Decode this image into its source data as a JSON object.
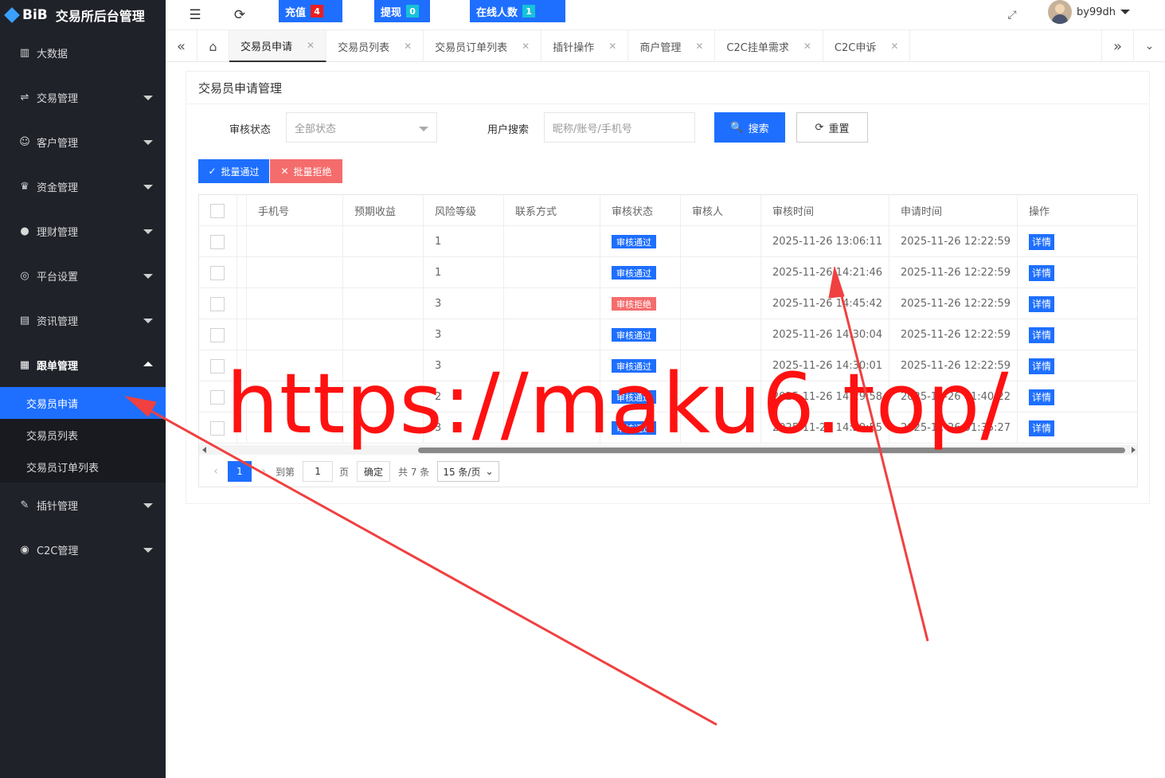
{
  "app": {
    "logo_text": "BiB",
    "title": "交易所后台管理"
  },
  "topbar": {
    "buttons": [
      {
        "label": "充值",
        "count": "4",
        "color": "#f01d1d"
      },
      {
        "label": "提现",
        "count": "0",
        "color": "#16c2d8"
      },
      {
        "label": "在线人数",
        "count": "1",
        "color": "#16c2d8"
      }
    ],
    "username": "by99dh"
  },
  "sidebar": {
    "items": [
      {
        "label": "大数据",
        "icon": "chart-icon"
      },
      {
        "label": "交易管理",
        "icon": "exchange-icon"
      },
      {
        "label": "客户管理",
        "icon": "users-icon"
      },
      {
        "label": "资金管理",
        "icon": "money-bag-icon"
      },
      {
        "label": "理财管理",
        "icon": "piggy-bank-icon"
      },
      {
        "label": "平台设置",
        "icon": "settings-icon"
      },
      {
        "label": "资讯管理",
        "icon": "news-icon"
      },
      {
        "label": "跟单管理",
        "icon": "document-icon"
      },
      {
        "label": "插针管理",
        "icon": "pin-icon"
      },
      {
        "label": "C2C管理",
        "icon": "coin-icon"
      }
    ],
    "sub_items": [
      "交易员申请",
      "交易员列表",
      "交易员订单列表"
    ]
  },
  "tabs": [
    "交易员申请",
    "交易员列表",
    "交易员订单列表",
    "插针操作",
    "商户管理",
    "C2C挂单需求",
    "C2C申诉"
  ],
  "page": {
    "title": "交易员申请管理",
    "status_label": "审核状态",
    "status_value": "全部状态",
    "user_search_label": "用户搜索",
    "user_search_placeholder": "昵称/账号/手机号",
    "search_button": "搜索",
    "reset_button": "重置",
    "batch_pass": "批量通过",
    "batch_reject": "批量拒绝"
  },
  "table": {
    "headers": [
      "手机号",
      "预期收益",
      "风险等级",
      "联系方式",
      "审核状态",
      "审核人",
      "审核时间",
      "申请时间",
      "操作"
    ],
    "rows": [
      {
        "phone": "",
        "profit": "",
        "risk": "1",
        "contact": "",
        "status": "审核通过",
        "status_type": "pass",
        "reviewer": "",
        "review_time": "2025-11-26 13:06:11",
        "apply_time": "2025-11-26 12:22:59",
        "action": "详情"
      },
      {
        "phone": "",
        "profit": "",
        "risk": "1",
        "contact": "",
        "status": "审核通过",
        "status_type": "pass",
        "reviewer": "",
        "review_time": "2025-11-26 14:21:46",
        "apply_time": "2025-11-26 12:22:59",
        "action": "详情"
      },
      {
        "phone": "",
        "profit": "",
        "risk": "3",
        "contact": "",
        "status": "审核拒绝",
        "status_type": "reject",
        "reviewer": "",
        "review_time": "2025-11-26 14:45:42",
        "apply_time": "2025-11-26 12:22:59",
        "action": "详情"
      },
      {
        "phone": "",
        "profit": "",
        "risk": "3",
        "contact": "",
        "status": "审核通过",
        "status_type": "pass",
        "reviewer": "",
        "review_time": "2025-11-26 14:30:04",
        "apply_time": "2025-11-26 12:22:59",
        "action": "详情"
      },
      {
        "phone": "",
        "profit": "",
        "risk": "3",
        "contact": "",
        "status": "审核通过",
        "status_type": "pass",
        "reviewer": "",
        "review_time": "2025-11-26 14:30:01",
        "apply_time": "2025-11-26 12:22:59",
        "action": "详情"
      },
      {
        "phone": "",
        "profit": "",
        "risk": "2",
        "contact": "",
        "status": "审核通过",
        "status_type": "pass",
        "reviewer": "",
        "review_time": "2025-11-26 14:29:58",
        "apply_time": "2025-11-26 01:40:22",
        "action": "详情"
      },
      {
        "phone": "",
        "profit": "",
        "risk": "3",
        "contact": "",
        "status": "审核通过",
        "status_type": "pass",
        "reviewer": "",
        "review_time": "2025-11-26 14:29:55",
        "apply_time": "2025-11-26 01:35:27",
        "action": "详情"
      }
    ]
  },
  "pagination": {
    "current_page": "1",
    "goto_label": "到第",
    "goto_value": "1",
    "page_label": "页",
    "confirm": "确定",
    "total": "共 7 条",
    "page_size": "15 条/页"
  },
  "watermark": "https://maku6.top/"
}
